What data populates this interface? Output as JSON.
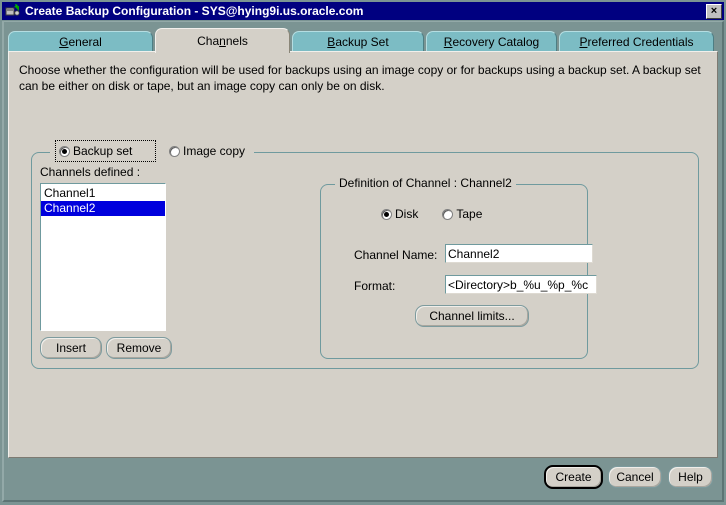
{
  "window": {
    "title": "Create Backup Configuration - SYS@hying9i.us.oracle.com",
    "icon": "backup-config-icon",
    "close_label": "×",
    "close_icon": "close-icon"
  },
  "tabs": [
    {
      "id": "general",
      "label": "General",
      "mnemonic_index": 0,
      "selected": false
    },
    {
      "id": "channels",
      "label": "Channels",
      "mnemonic_index": 4,
      "selected": true
    },
    {
      "id": "backup-set",
      "label": "Backup Set",
      "mnemonic_index": 0,
      "selected": false
    },
    {
      "id": "recovery-catalog",
      "label": "Recovery Catalog",
      "mnemonic_index": 0,
      "selected": false
    },
    {
      "id": "preferred-credentials",
      "label": "Preferred Credentials",
      "mnemonic_index": 0,
      "selected": false
    }
  ],
  "panel": {
    "instructions": "Choose whether the configuration will be used for backups using an image copy or for backups using a backup set.  A backup set can be either on disk or tape, but an image copy can only be on disk."
  },
  "backup_type": {
    "options": [
      {
        "id": "backup-set",
        "label": "Backup set",
        "checked": true,
        "focused": true
      },
      {
        "id": "image-copy",
        "label": "Image copy",
        "checked": false,
        "focused": false
      }
    ]
  },
  "channels": {
    "list_label": "Channels defined :",
    "items": [
      {
        "label": "Channel1",
        "selected": false
      },
      {
        "label": "Channel2",
        "selected": true
      }
    ],
    "insert_label": "Insert",
    "remove_label": "Remove"
  },
  "definition": {
    "legend": "Definition of Channel : Channel2",
    "media_options": [
      {
        "id": "disk",
        "label": "Disk",
        "checked": true
      },
      {
        "id": "tape",
        "label": "Tape",
        "checked": false
      }
    ],
    "channel_name_label": "Channel Name:",
    "channel_name_value": "Channel2",
    "format_label": "Format:",
    "format_value": "<Directory>b_%u_%p_%c",
    "channel_limits_label": "Channel limits..."
  },
  "footer": {
    "create_label": "Create",
    "cancel_label": "Cancel",
    "help_label": "Help"
  },
  "colors": {
    "titlebar": "#000080",
    "window_frame": "#7b9493",
    "panel": "#d4d0c8",
    "tab_inactive": "#7cbcc4",
    "selection": "#0000dd",
    "group_border": "#6f9a9e"
  }
}
